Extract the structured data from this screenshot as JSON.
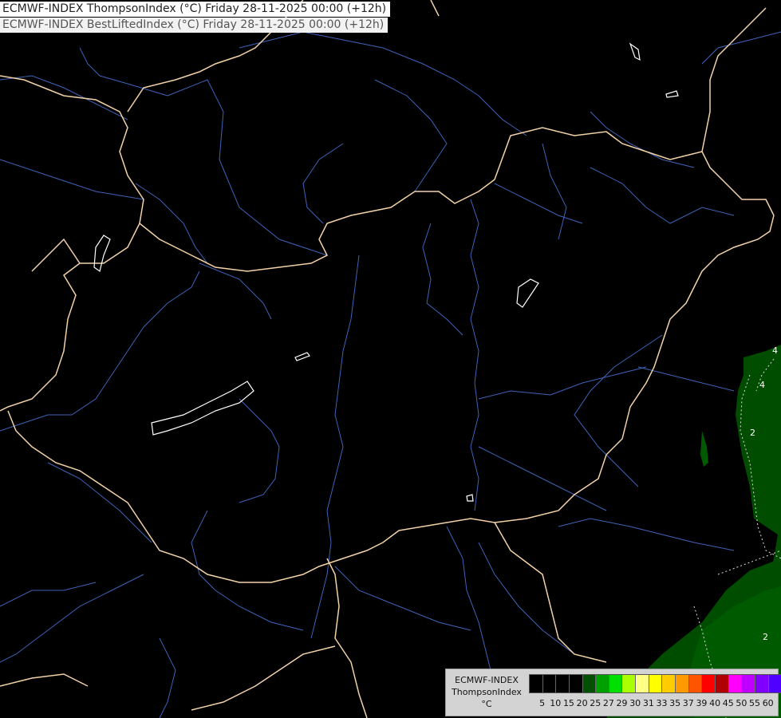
{
  "header": {
    "line1": "ECMWF-INDEX ThompsonIndex (°C) Friday 28-11-2025 00:00 (+12h)",
    "line2": "ECMWF-INDEX BestLiftedIndex (°C) Friday 28-11-2025 00:00 (+12h)"
  },
  "legend": {
    "title_line1": "ECMWF-INDEX",
    "title_line2": "ThompsonIndex",
    "title_line3": "°C",
    "colors": [
      "#000000",
      "#000000",
      "#000000",
      "#000000",
      "#005000",
      "#00a000",
      "#00e000",
      "#aaff00",
      "#ffff88",
      "#ffff00",
      "#ffcc00",
      "#ff9900",
      "#ff5500",
      "#ff0000",
      "#b00000",
      "#ff00ff",
      "#c000ff",
      "#8000ff",
      "#5000ff",
      "#0000ff"
    ],
    "tick_labels": [
      "5",
      "10",
      "15",
      "20",
      "25",
      "27",
      "29",
      "30",
      "31",
      "33",
      "35",
      "37",
      "39",
      "40",
      "45",
      "50",
      "55",
      "60"
    ]
  },
  "contour_labels": {
    "a": "4",
    "b": "4",
    "c": "2",
    "d": "2"
  },
  "colors": {
    "border": "#f2d2a8",
    "river": "#3f63b8",
    "lake": "#ffffff",
    "field_dark": "#004d00",
    "field_mid": "#005a00"
  }
}
